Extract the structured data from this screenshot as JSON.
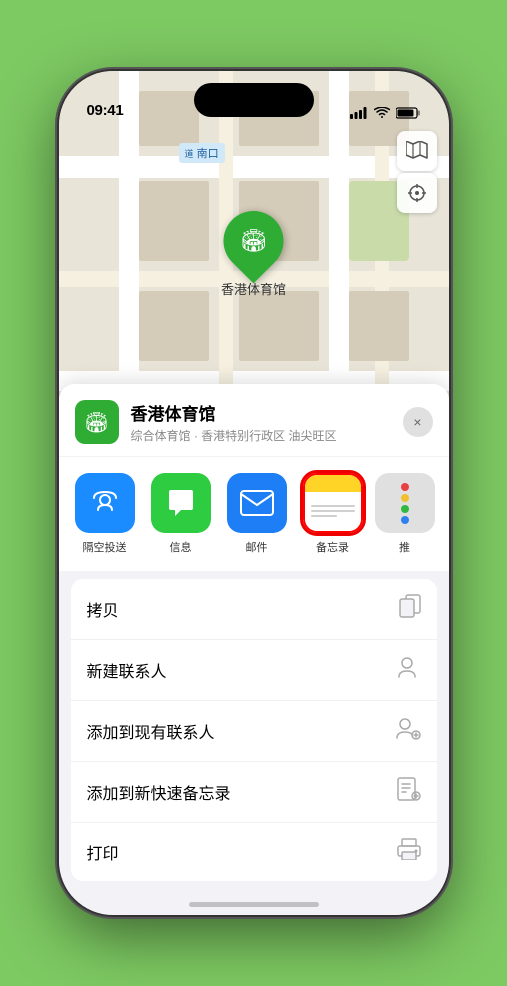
{
  "status_bar": {
    "time": "09:41",
    "signal": "●●●",
    "wifi": "wifi",
    "battery": "battery"
  },
  "map": {
    "road_label": "南口",
    "pin_label": "香港体育馆"
  },
  "location_card": {
    "name": "香港体育馆",
    "description": "综合体育馆 · 香港特别行政区 油尖旺区",
    "close_label": "×"
  },
  "share_items": [
    {
      "id": "airdrop",
      "label": "隔空投送",
      "type": "airdrop"
    },
    {
      "id": "messages",
      "label": "信息",
      "type": "messages"
    },
    {
      "id": "mail",
      "label": "邮件",
      "type": "mail"
    },
    {
      "id": "notes",
      "label": "备忘录",
      "type": "notes"
    },
    {
      "id": "more",
      "label": "推",
      "type": "more"
    }
  ],
  "menu_items": [
    {
      "id": "copy",
      "label": "拷贝",
      "icon": "copy"
    },
    {
      "id": "new-contact",
      "label": "新建联系人",
      "icon": "person-add"
    },
    {
      "id": "add-existing",
      "label": "添加到现有联系人",
      "icon": "person-badge"
    },
    {
      "id": "quick-note",
      "label": "添加到新快速备忘录",
      "icon": "note-add"
    },
    {
      "id": "print",
      "label": "打印",
      "icon": "print"
    }
  ]
}
